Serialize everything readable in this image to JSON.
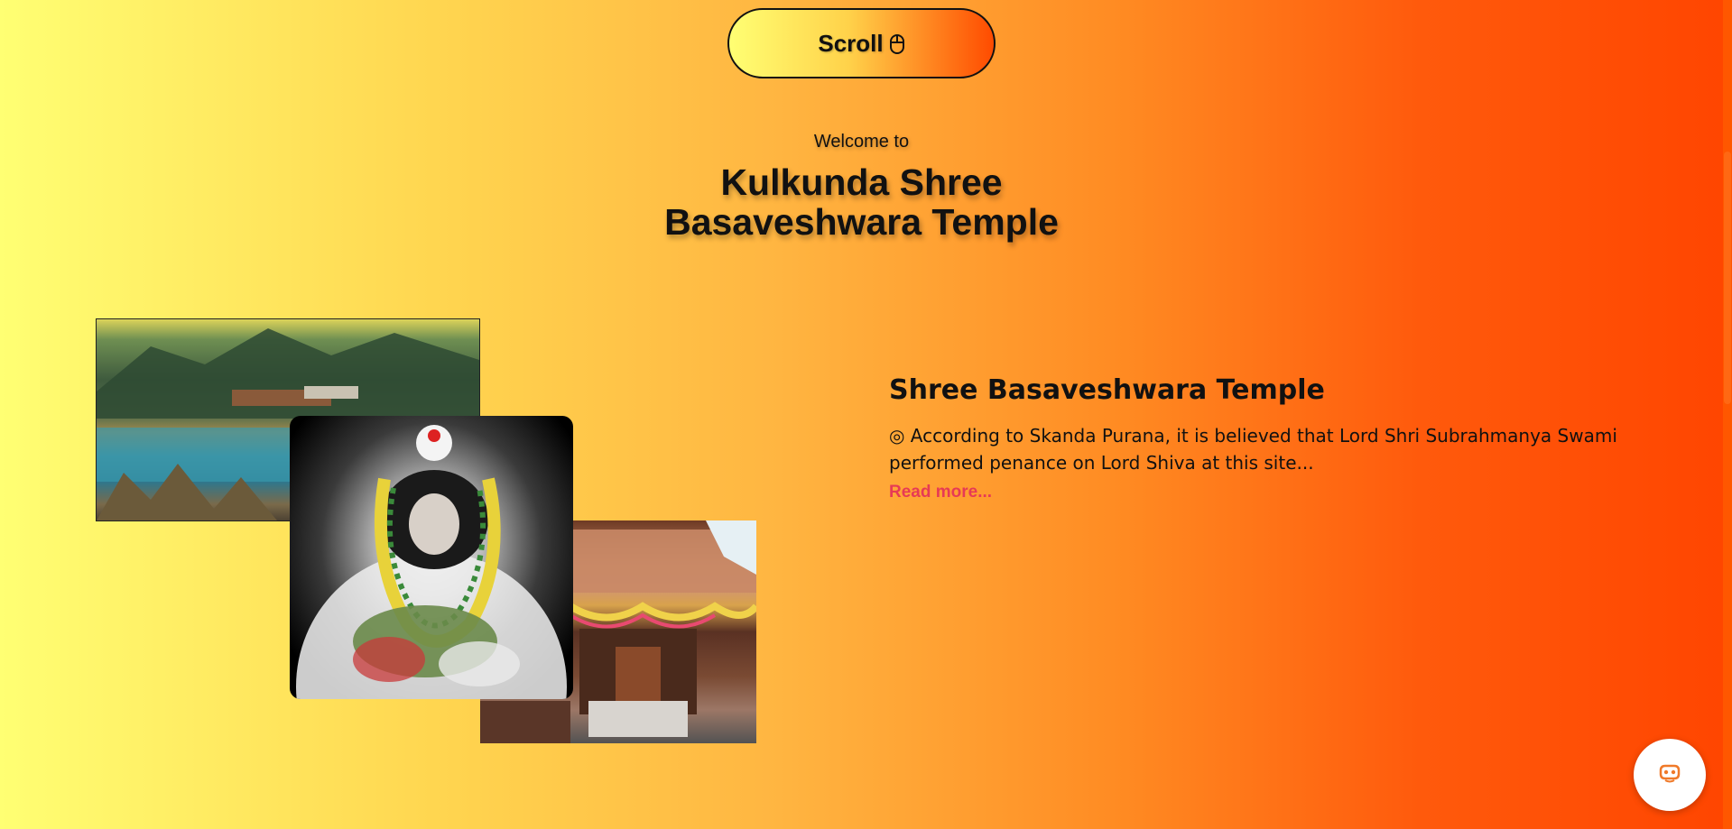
{
  "scroll_button": {
    "label": "Scroll",
    "icon": "mouse-icon"
  },
  "hero": {
    "welcome": "Welcome to",
    "title": "Kulkunda Shree Basaveshwara Temple"
  },
  "gallery": {
    "images": [
      {
        "name": "lake-landscape-photo"
      },
      {
        "name": "basaveshwara-idol-photo"
      },
      {
        "name": "temple-shrine-photo"
      }
    ]
  },
  "section": {
    "heading": "Shree Basaveshwara Temple",
    "description": "◎ According to Skanda Purana, it is believed that Lord Shri Subrahmanya Swami performed penance on Lord Shiva at this site...",
    "read_more": "Read more..."
  },
  "chat_widget": {
    "icon": "chat-bot-icon"
  },
  "colors": {
    "gradient_start": "#ffff73",
    "gradient_end": "#ff4500",
    "link": "#e73a55",
    "chat_icon": "#f07a2a"
  }
}
